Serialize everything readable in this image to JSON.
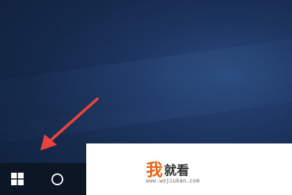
{
  "taskbar": {
    "start_icon": "windows-logo-icon",
    "search_icon": "cortana-circle-icon"
  },
  "annotation": {
    "icon": "red-arrow-icon",
    "color": "#e8433f"
  },
  "watermark": {
    "char1": "我",
    "chars_rest": "就看",
    "url": "www.wojiukan.com",
    "accent_color": "#e8641b"
  }
}
